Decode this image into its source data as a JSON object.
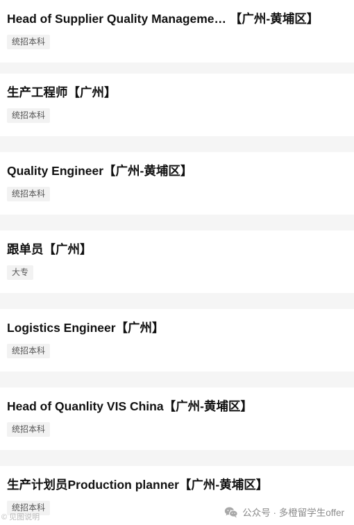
{
  "jobs": [
    {
      "title": "Head of Supplier Quality Manageme… 【广州-黄埔区】",
      "tag": "统招本科"
    },
    {
      "title": "生产工程师【广州】",
      "tag": "统招本科"
    },
    {
      "title": "Quality Engineer【广州-黄埔区】",
      "tag": "统招本科"
    },
    {
      "title": "跟单员【广州】",
      "tag": "大专"
    },
    {
      "title": "Logistics Engineer【广州】",
      "tag": "统招本科"
    },
    {
      "title": "Head of Quanlity VIS China【广州-黄埔区】",
      "tag": "统招本科"
    },
    {
      "title": "生产计划员Production planner【广州-黄埔区】",
      "tag": "统招本科"
    }
  ],
  "watermark": {
    "left_text": "© 见图说明",
    "right_text": "公众号 · 多橙留学生offer",
    "icon": "wechat-icon"
  }
}
